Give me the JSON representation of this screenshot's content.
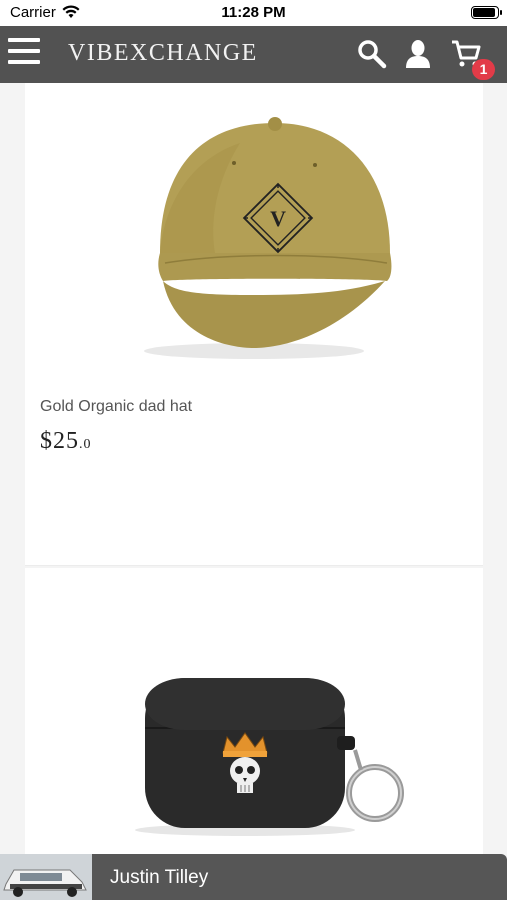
{
  "status": {
    "carrier": "Carrier",
    "time": "11:28 PM"
  },
  "nav": {
    "brand": "VIBEXCHANGE",
    "cart_count": "1"
  },
  "products": [
    {
      "name": "Gold Organic dad hat",
      "price_main": "$25",
      "price_cents": ".0",
      "hat_color": "#b39f55",
      "emblem_letter": "V"
    },
    {
      "name": "",
      "case_color": "#2a2a2a"
    }
  ],
  "bottom_bar": {
    "label": "Justin Tilley"
  },
  "colors": {
    "nav_bg": "#525252",
    "badge": "#e23b48",
    "bottom_bar": "#565656"
  }
}
